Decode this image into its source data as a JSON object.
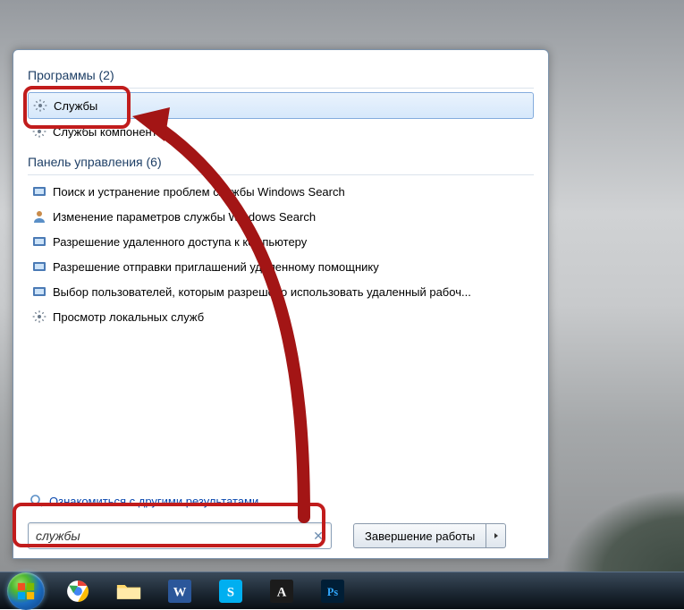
{
  "sections": {
    "programs": {
      "header": "Программы (2)",
      "items": [
        "Службы",
        "Службы компонентов"
      ]
    },
    "control_panel": {
      "header": "Панель управления (6)",
      "items": [
        "Поиск и устранение проблем службы Windows Search",
        "Изменение параметров службы Windows Search",
        "Разрешение удаленного доступа к компьютеру",
        "Разрешение отправки приглашений удаленному помощнику",
        "Выбор пользователей, которым разрешено использовать удаленный рабоч...",
        "Просмотр локальных служб"
      ]
    }
  },
  "more_results": "Ознакомиться с другими результатами",
  "search": {
    "value": "службы"
  },
  "shutdown": {
    "label": "Завершение работы"
  },
  "colors": {
    "highlight": "#c11c1c",
    "link": "#0645ad",
    "header": "#1e3f66"
  }
}
